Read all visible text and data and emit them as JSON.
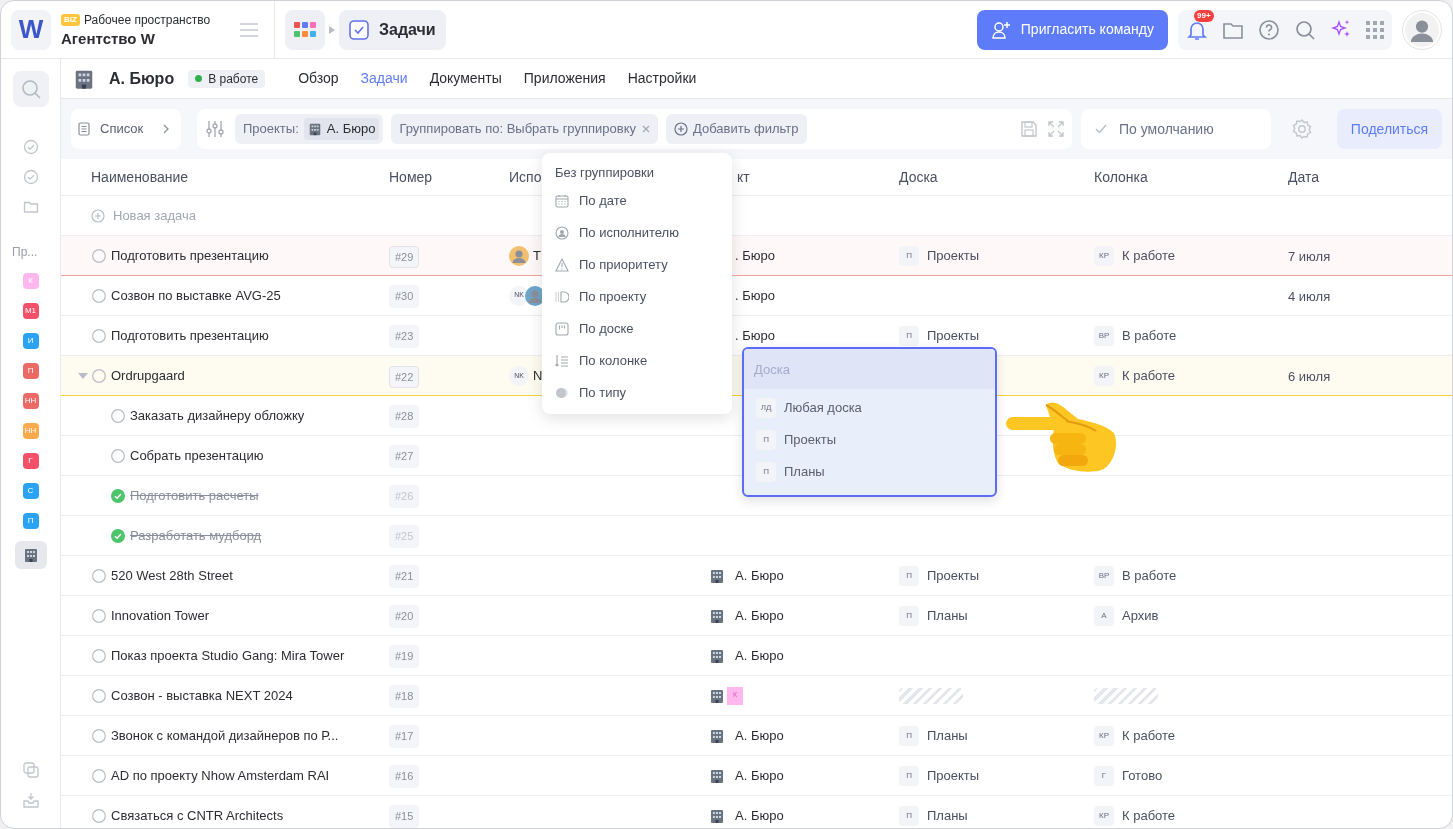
{
  "workspace": {
    "logo": "W",
    "badge": "BIZ",
    "label": "Рабочее пространство",
    "name": "Агентство W"
  },
  "breadcrumb": {
    "current": "Задачи"
  },
  "invite_button": "Пригласить команду",
  "notifications": {
    "count": "99+"
  },
  "sidebar": {
    "section_label": "Пр...",
    "projects": [
      {
        "kind": "tag",
        "label": "К",
        "color": "#ffb8ee",
        "selected": false
      },
      {
        "kind": "tag",
        "label": "М1",
        "color": "#f4506a",
        "selected": false
      },
      {
        "kind": "tag",
        "label": "И",
        "color": "#2ba3f5",
        "selected": false
      },
      {
        "kind": "tag",
        "label": "П",
        "color": "#ec6a66",
        "selected": false
      },
      {
        "kind": "tag",
        "label": "НН",
        "color": "#ec6a66",
        "selected": false
      },
      {
        "kind": "tag",
        "label": "НН",
        "color": "#ffa94d",
        "selected": false
      },
      {
        "kind": "tag",
        "label": "Г",
        "color": "#f5506a",
        "selected": false
      },
      {
        "kind": "tag",
        "label": "С",
        "color": "#2ba3f5",
        "selected": false
      },
      {
        "kind": "tag",
        "label": "П",
        "color": "#2ba3f5",
        "selected": false
      },
      {
        "kind": "building",
        "selected": true
      }
    ]
  },
  "project": {
    "name": "А. Бюро",
    "status": "В работе"
  },
  "tabs": [
    {
      "label": "Обзор",
      "selected": false
    },
    {
      "label": "Задачи",
      "selected": true
    },
    {
      "label": "Документы",
      "selected": false
    },
    {
      "label": "Приложения",
      "selected": false
    },
    {
      "label": "Настройки",
      "selected": false
    }
  ],
  "toolbar": {
    "view": "Список",
    "filter_label": "Проекты:",
    "filter_value": "А. Бюро",
    "grouping": "Группировать по: Выбрать группировку",
    "add_filter": "Добавить фильтр",
    "preset": "По умолчанию",
    "share": "Поделиться"
  },
  "table": {
    "columns": [
      "Наименование",
      "Номер",
      "Испо",
      "кт",
      "Доска",
      "Колонка",
      "Дата"
    ],
    "new_task": "Новая задача",
    "rows": [
      {
        "title": "Подготовить презентацию",
        "number": "#29",
        "done": false,
        "color": "#f6a3a0",
        "assignee": {
          "photo": true,
          "text": "Т"
        },
        "project": {
          "icon": false,
          "text": ". Бюро"
        },
        "board": {
          "abbr": "П",
          "text": "Проекты"
        },
        "column": {
          "abbr": "КР",
          "text": "К работе"
        },
        "date": "7 июля"
      },
      {
        "title": "Созвон по выставке AVG-25",
        "number": "#30",
        "done": false,
        "assignee": {
          "initials": "NK",
          "photo": true
        },
        "project": {
          "icon": false,
          "text": ". Бюро"
        },
        "date": "4 июля"
      },
      {
        "title": "Подготовить презентацию",
        "number": "#23",
        "done": false,
        "project": {
          "icon": false,
          "text": ". Бюро"
        },
        "board": {
          "abbr": "П",
          "text": "Проекты"
        },
        "column": {
          "abbr": "ВР",
          "text": "В работе"
        }
      },
      {
        "title": "Ordrupgaard",
        "number": "#22",
        "done": false,
        "color": "#f3d33f",
        "expanded": true,
        "assignee": {
          "initials": "NK",
          "photo": false,
          "text": "N"
        },
        "column": {
          "abbr": "КР",
          "text": "К работе"
        },
        "date": "6 июля",
        "children": [
          {
            "title": "Заказать дизайнеру обложку",
            "number": "#28",
            "done": false
          },
          {
            "title": "Собрать презентацию",
            "number": "#27",
            "done": false
          },
          {
            "title": "Подготовить расчеты",
            "number": "#26",
            "done": true
          },
          {
            "title": "Разработать мудборд",
            "number": "#25",
            "done": true
          }
        ]
      },
      {
        "title": "520 West 28th Street",
        "number": "#21",
        "done": false,
        "project": {
          "icon": true,
          "text": "А. Бюро"
        },
        "board": {
          "abbr": "П",
          "text": "Проекты"
        },
        "column": {
          "abbr": "ВР",
          "text": "В работе"
        }
      },
      {
        "title": "Innovation Tower",
        "number": "#20",
        "done": false,
        "project": {
          "icon": true,
          "text": "А. Бюро"
        },
        "board": {
          "abbr": "П",
          "text": "Планы"
        },
        "column": {
          "abbr": "А",
          "text": "Архив"
        }
      },
      {
        "title": "Показ проекта Studio Gang: Mira Tower",
        "number": "#19",
        "done": false,
        "project": {
          "icon": true,
          "text": "А. Бюро"
        }
      },
      {
        "title": "Созвон - выставка NEXT 2024",
        "number": "#18",
        "done": false,
        "project": {
          "icon": true,
          "tag": "К",
          "color": "#ffb8ee"
        },
        "board": {
          "kind": "loading"
        },
        "column": {
          "kind": "loading"
        }
      },
      {
        "title": "Звонок с командой дизайнеров по Р...",
        "number": "#17",
        "done": false,
        "project": {
          "icon": true,
          "text": "А. Бюро"
        },
        "board": {
          "abbr": "П",
          "text": "Планы"
        },
        "column": {
          "abbr": "КР",
          "text": "К работе"
        }
      },
      {
        "title": "AD по проекту Nhow Amsterdam RAI",
        "number": "#16",
        "done": false,
        "project": {
          "icon": true,
          "text": "А. Бюро"
        },
        "board": {
          "abbr": "П",
          "text": "Проекты"
        },
        "column": {
          "abbr": "Г",
          "text": "Готово"
        }
      },
      {
        "title": "Связаться с CNTR Architects",
        "number": "#15",
        "done": false,
        "project": {
          "icon": true,
          "text": "А. Бюро"
        },
        "board": {
          "abbr": "П",
          "text": "Планы"
        },
        "column": {
          "abbr": "КР",
          "text": "К работе"
        }
      }
    ]
  },
  "grouping_menu": {
    "title": "Без группировки",
    "items": [
      {
        "kind": "date",
        "label": "По дате"
      },
      {
        "kind": "assignee",
        "label": "По исполнителю"
      },
      {
        "kind": "priority",
        "label": "По приоритету"
      },
      {
        "kind": "project",
        "label": "По проекту"
      },
      {
        "kind": "board",
        "label": "По доске"
      },
      {
        "kind": "column",
        "label": "По колонке"
      },
      {
        "kind": "type",
        "label": "По типу"
      }
    ]
  },
  "board_menu": {
    "placeholder": "Доска",
    "items": [
      {
        "abbr": "ЛД",
        "label": "Любая доска"
      },
      {
        "abbr": "П",
        "label": "Проекты"
      },
      {
        "abbr": "П",
        "label": "Планы"
      }
    ]
  }
}
